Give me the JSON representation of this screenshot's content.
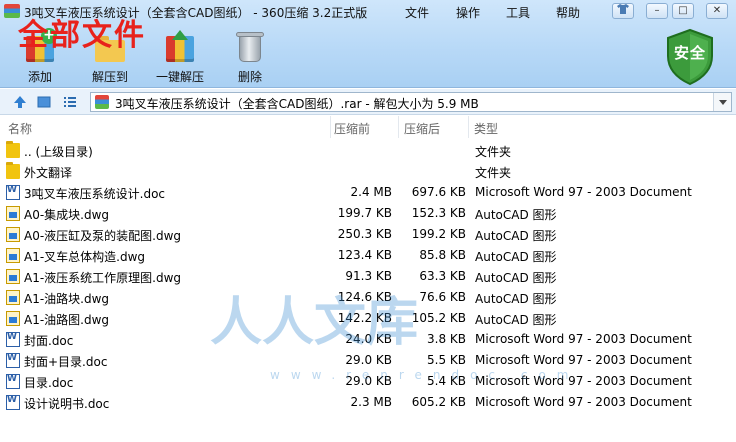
{
  "window": {
    "title": "3吨叉车液压系统设计（全套含CAD图纸） - 360压缩 3.2正式版",
    "menu": [
      "文件",
      "操作",
      "工具",
      "帮助"
    ],
    "controls": {
      "minimize": "–",
      "maximize": "□",
      "close": "✕"
    }
  },
  "overlay_text": "全部文件",
  "toolbar": {
    "buttons": [
      {
        "label": "添加",
        "icon": "add-icon"
      },
      {
        "label": "解压到",
        "icon": "extract-to-icon"
      },
      {
        "label": "一键解压",
        "icon": "one-click-extract-icon"
      },
      {
        "label": "删除",
        "icon": "delete-icon"
      }
    ],
    "security_label": "安全"
  },
  "address": {
    "path": "3吨叉车液压系统设计（全套含CAD图纸）.rar - 解包大小为 5.9 MB"
  },
  "columns": [
    "名称",
    "压缩前",
    "压缩后",
    "类型"
  ],
  "files": [
    {
      "name": ".. (上级目录)",
      "before": "",
      "after": "",
      "type": "文件夹",
      "icon": "folder-icon"
    },
    {
      "name": "外文翻译",
      "before": "",
      "after": "",
      "type": "文件夹",
      "icon": "folder-icon"
    },
    {
      "name": "3吨叉车液压系统设计.doc",
      "before": "2.4 MB",
      "after": "697.6 KB",
      "type": "Microsoft Word 97 - 2003 Document",
      "icon": "word-doc-icon"
    },
    {
      "name": "A0-集成块.dwg",
      "before": "199.7 KB",
      "after": "152.3 KB",
      "type": "AutoCAD 图形",
      "icon": "dwg-icon"
    },
    {
      "name": "A0-液压缸及泵的装配图.dwg",
      "before": "250.3 KB",
      "after": "199.2 KB",
      "type": "AutoCAD 图形",
      "icon": "dwg-icon"
    },
    {
      "name": "A1-叉车总体构造.dwg",
      "before": "123.4 KB",
      "after": "85.8 KB",
      "type": "AutoCAD 图形",
      "icon": "dwg-icon"
    },
    {
      "name": "A1-液压系统工作原理图.dwg",
      "before": "91.3 KB",
      "after": "63.3 KB",
      "type": "AutoCAD 图形",
      "icon": "dwg-icon"
    },
    {
      "name": "A1-油路块.dwg",
      "before": "124.6 KB",
      "after": "76.6 KB",
      "type": "AutoCAD 图形",
      "icon": "dwg-icon"
    },
    {
      "name": "A1-油路图.dwg",
      "before": "142.2 KB",
      "after": "105.2 KB",
      "type": "AutoCAD 图形",
      "icon": "dwg-icon"
    },
    {
      "name": "封面.doc",
      "before": "24.0 KB",
      "after": "3.8 KB",
      "type": "Microsoft Word 97 - 2003 Document",
      "icon": "word-doc-icon"
    },
    {
      "name": "封面+目录.doc",
      "before": "29.0 KB",
      "after": "5.5 KB",
      "type": "Microsoft Word 97 - 2003 Document",
      "icon": "word-doc-icon"
    },
    {
      "name": "目录.doc",
      "before": "29.0 KB",
      "after": "5.4 KB",
      "type": "Microsoft Word 97 - 2003 Document",
      "icon": "word-doc-icon"
    },
    {
      "name": "设计说明书.doc",
      "before": "2.3 MB",
      "after": "605.2 KB",
      "type": "Microsoft Word 97 - 2003 Document",
      "icon": "word-doc-icon"
    }
  ],
  "watermark": {
    "text": "人人文库",
    "url": "www.renrendoc.com"
  }
}
